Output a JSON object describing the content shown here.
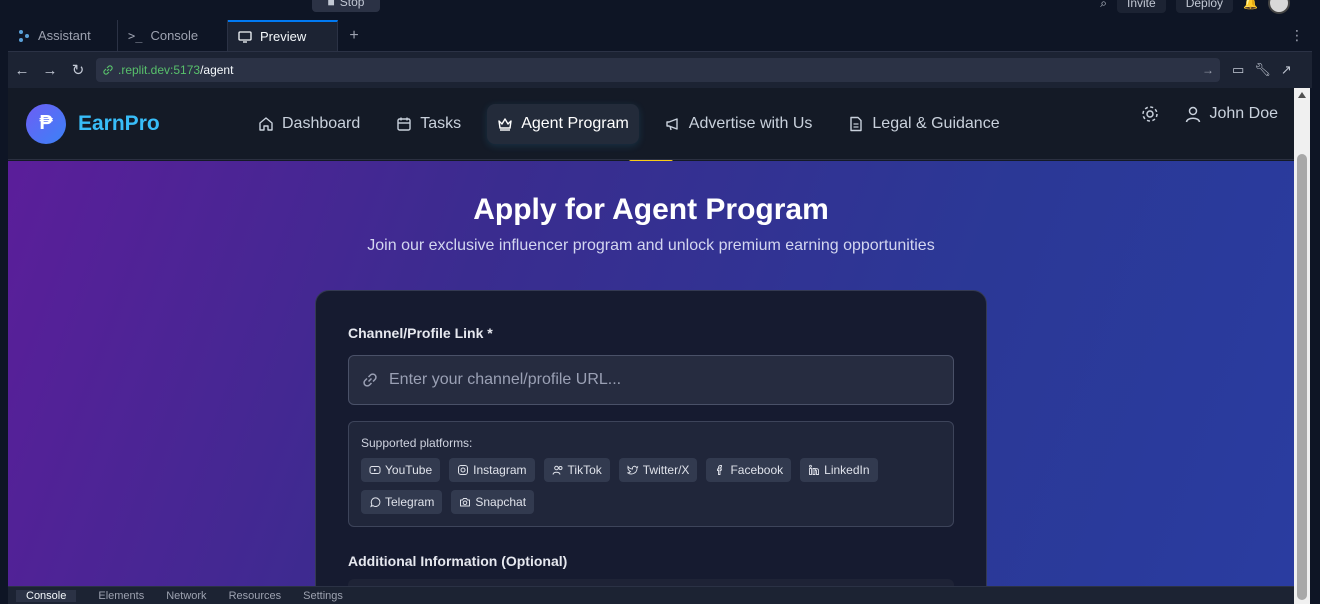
{
  "topbar": {
    "stop_label": "Stop",
    "invite_label": "Invite",
    "deploy_label": "Deploy"
  },
  "tabs": [
    {
      "label": "Assistant",
      "icon": "assistant-icon"
    },
    {
      "label": "Console",
      "icon": "terminal-icon"
    },
    {
      "label": "Preview",
      "icon": "monitor-icon"
    }
  ],
  "url": {
    "host": ".replit.dev:5173",
    "path": "/agent"
  },
  "app": {
    "brand": "EarnPro",
    "logo_glyph": "₱",
    "nav": [
      {
        "label": "Dashboard",
        "icon": "home-icon"
      },
      {
        "label": "Tasks",
        "icon": "calendar-icon"
      },
      {
        "label": "Agent Program",
        "icon": "crown-icon"
      },
      {
        "label": "Advertise with Us",
        "icon": "megaphone-icon"
      },
      {
        "label": "Legal & Guidance",
        "icon": "document-icon"
      }
    ],
    "user_name": "John Doe"
  },
  "hero": {
    "title": "Apply for Agent Program",
    "subtitle": "Join our exclusive influencer program and unlock premium earning opportunities"
  },
  "form": {
    "channel_label": "Channel/Profile Link *",
    "channel_placeholder": "Enter your channel/profile URL...",
    "platforms_title": "Supported platforms:",
    "platforms": [
      "YouTube",
      "Instagram",
      "TikTok",
      "Twitter/X",
      "Facebook",
      "LinkedIn",
      "Telegram",
      "Snapchat"
    ],
    "additional_label": "Additional Information (Optional)"
  },
  "devtools": {
    "tabs": [
      "Console",
      "Elements",
      "Network",
      "Resources",
      "Settings"
    ]
  },
  "colors": {
    "accent": "#38bdf8",
    "indicator": "#facc15",
    "replit_blue": "#0079f2"
  }
}
